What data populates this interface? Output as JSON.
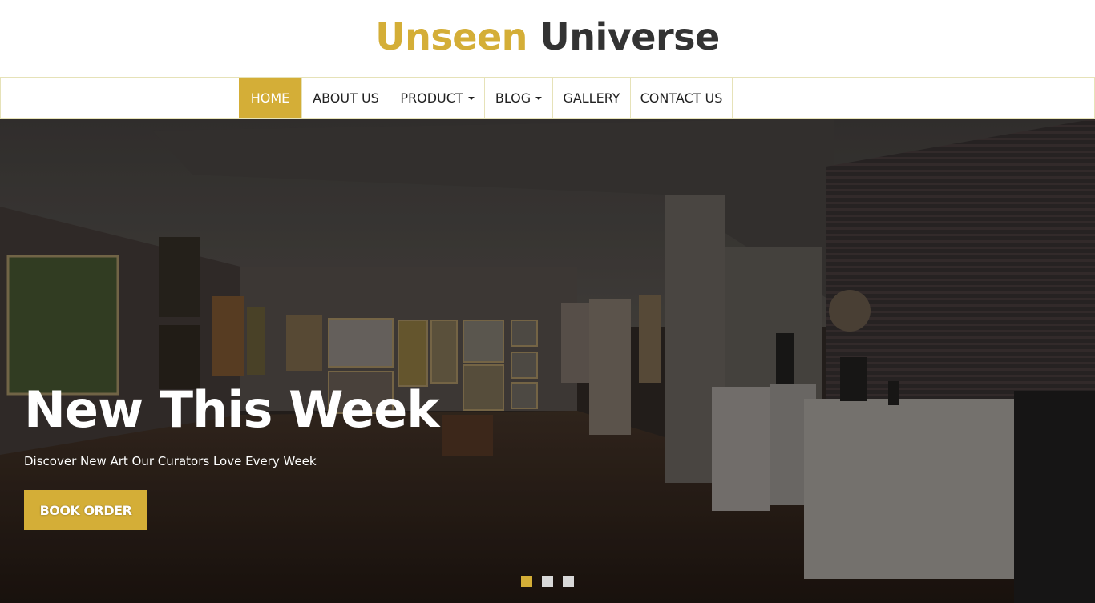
{
  "logo": {
    "word1": "Unseen",
    "word2": "Universe"
  },
  "nav": {
    "items": [
      {
        "label": "HOME",
        "active": true,
        "dropdown": false
      },
      {
        "label": "ABOUT US",
        "active": false,
        "dropdown": false
      },
      {
        "label": "PRODUCT",
        "active": false,
        "dropdown": true
      },
      {
        "label": "BLOG",
        "active": false,
        "dropdown": true
      },
      {
        "label": "GALLERY",
        "active": false,
        "dropdown": false
      },
      {
        "label": "CONTACT US",
        "active": false,
        "dropdown": false
      }
    ]
  },
  "hero": {
    "title": "New This Week",
    "subtitle": "Discover New Art Our Curators Love Every Week",
    "button_label": "BOOK ORDER",
    "slides": 3,
    "active_slide": 1
  },
  "colors": {
    "accent": "#d4ae37",
    "dark": "#333333",
    "border": "#e6e2b8"
  }
}
